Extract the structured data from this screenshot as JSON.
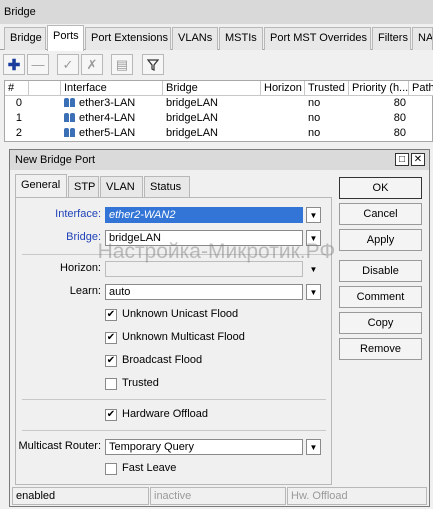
{
  "window": {
    "title": "Bridge"
  },
  "tabs": [
    "Bridge",
    "Ports",
    "Port Extensions",
    "VLANs",
    "MSTIs",
    "Port MST Overrides",
    "Filters",
    "NAT"
  ],
  "toolbar": {
    "icons": [
      "add-icon",
      "remove-icon",
      "enable-icon",
      "disable-icon",
      "comment-icon",
      "filter-icon"
    ]
  },
  "table": {
    "columns": [
      "#",
      "",
      "Interface",
      "Bridge",
      "Horizon",
      "Trusted",
      "Priority (h...",
      "Path"
    ],
    "rows": [
      {
        "num": "0",
        "interface": "ether3-LAN",
        "bridge": "bridgeLAN",
        "horizon": "",
        "trusted": "no",
        "priority": "80"
      },
      {
        "num": "1",
        "interface": "ether4-LAN",
        "bridge": "bridgeLAN",
        "horizon": "",
        "trusted": "no",
        "priority": "80"
      },
      {
        "num": "2",
        "interface": "ether5-LAN",
        "bridge": "bridgeLAN",
        "horizon": "",
        "trusted": "no",
        "priority": "80"
      }
    ]
  },
  "dialog": {
    "title": "New Bridge Port",
    "tabs": [
      "General",
      "STP",
      "VLAN",
      "Status"
    ],
    "interface": {
      "label": "Interface:",
      "value": "ether2-WAN2"
    },
    "bridge": {
      "label": "Bridge:",
      "value": "bridgeLAN"
    },
    "horizon": {
      "label": "Horizon:",
      "value": ""
    },
    "learn": {
      "label": "Learn:",
      "value": "auto"
    },
    "checks": {
      "unknown_unicast": {
        "label": "Unknown Unicast Flood",
        "checked": true
      },
      "unknown_multicast": {
        "label": "Unknown Multicast Flood",
        "checked": true
      },
      "broadcast": {
        "label": "Broadcast Flood",
        "checked": true
      },
      "trusted": {
        "label": "Trusted",
        "checked": false
      },
      "hw_offload": {
        "label": "Hardware Offload",
        "checked": true
      },
      "fast_leave": {
        "label": "Fast Leave",
        "checked": false
      }
    },
    "multicast_router": {
      "label": "Multicast Router:",
      "value": "Temporary Query"
    },
    "buttons": {
      "ok": "OK",
      "cancel": "Cancel",
      "apply": "Apply",
      "disable": "Disable",
      "comment": "Comment",
      "copy": "Copy",
      "remove": "Remove"
    },
    "status": {
      "enabled": "enabled",
      "inactive": "inactive",
      "hw_offload": "Hw. Offload"
    }
  },
  "watermark": "Настройка-Микротик.РФ",
  "colors": {
    "link_label": "#2043b8",
    "selection": "#3375d6"
  }
}
